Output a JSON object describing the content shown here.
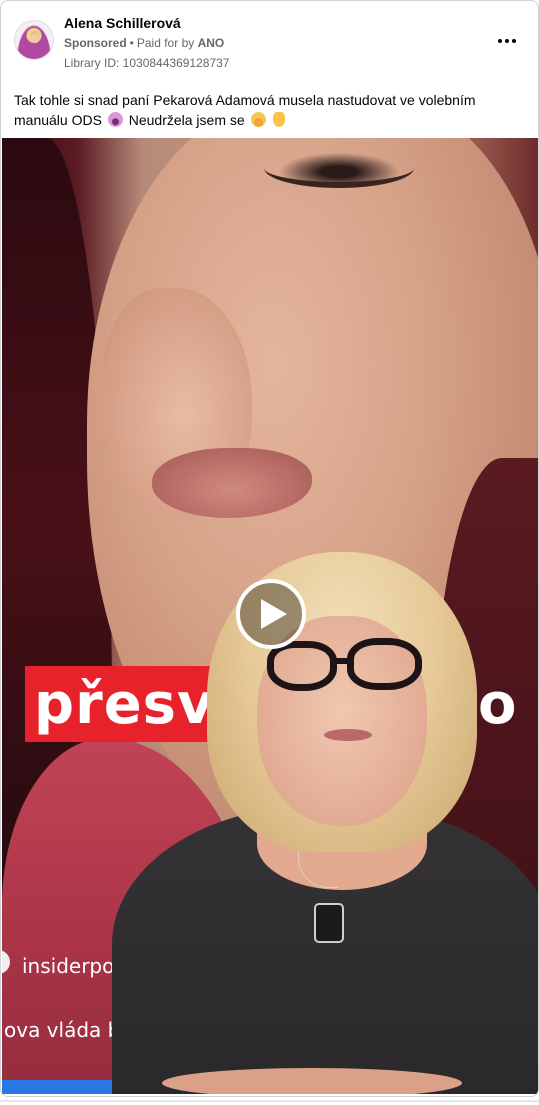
{
  "post": {
    "page_name": "Alena Schillerová",
    "sponsored_label": "Sponsored",
    "paid_for_prefix": "Paid for by",
    "payer": "ANO",
    "library_id": "Library ID: 1030844369128737",
    "text_part1": "Tak tohle si snad paní Pekarová Adamová musela nastudovat ve volebním manuálu ODS",
    "text_part2": "Neudržela jsem se"
  },
  "media": {
    "caption_main": "přesvě",
    "caption_suffix": "o",
    "handle_text": "insiderpoc",
    "subtitle_text": "ova vláda bu"
  },
  "icons": {
    "more": "more-options-icon",
    "play": "play-icon"
  }
}
